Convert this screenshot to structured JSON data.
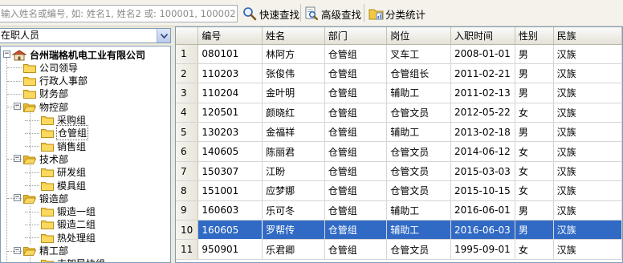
{
  "toolbar": {
    "search_placeholder": "输入姓名或编号, 如: 姓名1, 姓名2 或: 100001, 100002",
    "quick_find_label": "快速查找",
    "advanced_find_label": "高级查找",
    "category_stats_label": "分类统计"
  },
  "filter": {
    "selected": "在职人员"
  },
  "tree": {
    "root": "台州瑞格机电工业有限公司",
    "nodes": [
      {
        "label": "公司领导"
      },
      {
        "label": "行政人事部"
      },
      {
        "label": "财务部"
      },
      {
        "label": "物控部"
      },
      {
        "label": "采购组"
      },
      {
        "label": "仓管组"
      },
      {
        "label": "销售组"
      },
      {
        "label": "技术部"
      },
      {
        "label": "研发组"
      },
      {
        "label": "模具组"
      },
      {
        "label": "锻造部"
      },
      {
        "label": "锻造一组"
      },
      {
        "label": "锻造二组"
      },
      {
        "label": "热处理组"
      },
      {
        "label": "精工部"
      },
      {
        "label": "支架导块组"
      }
    ]
  },
  "grid": {
    "columns": [
      "",
      "编号",
      "姓名",
      "部门",
      "岗位",
      "入职时间",
      "性别",
      "民族"
    ],
    "rows": [
      [
        "1",
        "080101",
        "林阿方",
        "仓管组",
        "叉车工",
        "2008-01-01",
        "男",
        "汉族"
      ],
      [
        "2",
        "110203",
        "张俊伟",
        "仓管组",
        "仓管组长",
        "2011-02-21",
        "男",
        "汉族"
      ],
      [
        "3",
        "110204",
        "金叶明",
        "仓管组",
        "辅助工",
        "2011-02-13",
        "男",
        "汉族"
      ],
      [
        "4",
        "120501",
        "颜晓红",
        "仓管组",
        "仓管文员",
        "2012-05-22",
        "女",
        "汉族"
      ],
      [
        "5",
        "130203",
        "金福祥",
        "仓管组",
        "辅助工",
        "2013-02-18",
        "男",
        "汉族"
      ],
      [
        "6",
        "140605",
        "陈丽君",
        "仓管组",
        "仓管文员",
        "2014-06-12",
        "女",
        "汉族"
      ],
      [
        "7",
        "150307",
        "江盼",
        "仓管组",
        "仓管文员",
        "2015-03-03",
        "女",
        "汉族"
      ],
      [
        "8",
        "151001",
        "应梦娜",
        "仓管组",
        "仓管文员",
        "2015-10-15",
        "女",
        "汉族"
      ],
      [
        "9",
        "160603",
        "乐可冬",
        "仓管组",
        "辅助工",
        "2016-06-01",
        "男",
        "汉族"
      ],
      [
        "10",
        "160605",
        "罗帮传",
        "仓管组",
        "辅助工",
        "2016-06-03",
        "男",
        "汉族"
      ],
      [
        "11",
        "950901",
        "乐君卿",
        "仓管组",
        "仓管文员",
        "1995-09-01",
        "女",
        "汉族"
      ]
    ]
  },
  "colors": {
    "selection": "#316ac5",
    "folder": "#f5c842"
  }
}
